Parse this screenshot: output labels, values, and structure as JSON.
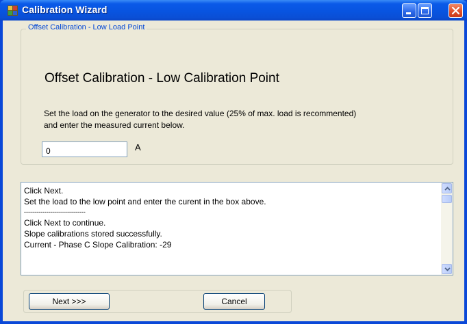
{
  "window": {
    "title": "Calibration Wizard"
  },
  "titlebar": {
    "icon": "app-icon",
    "controls": [
      "minimize-icon",
      "maximize-icon",
      "close-icon"
    ]
  },
  "group": {
    "legend": "Offset Calibration - Low Load Point"
  },
  "main": {
    "heading": "Offset Calibration - Low Calibration Point",
    "instruction_line1": "Set the load on the generator to the desired value (25% of max. load is recommented)",
    "instruction_line2": "and enter the measured current below.",
    "current_value": "0",
    "unit": "A"
  },
  "log": {
    "lines": [
      "Click Next.",
      "Set the load to the low point and enter the curent in the box above.",
      "------------------------------",
      "Click Next to continue.",
      "Slope calibrations stored successfully.",
      "Current - Phase C Slope Calibration: -29"
    ]
  },
  "buttons": {
    "next": "Next >>>",
    "cancel": "Cancel"
  },
  "colors": {
    "titlebar": "#0a54e0",
    "client_bg": "#ece9d8",
    "legend_text": "#0046d5"
  }
}
